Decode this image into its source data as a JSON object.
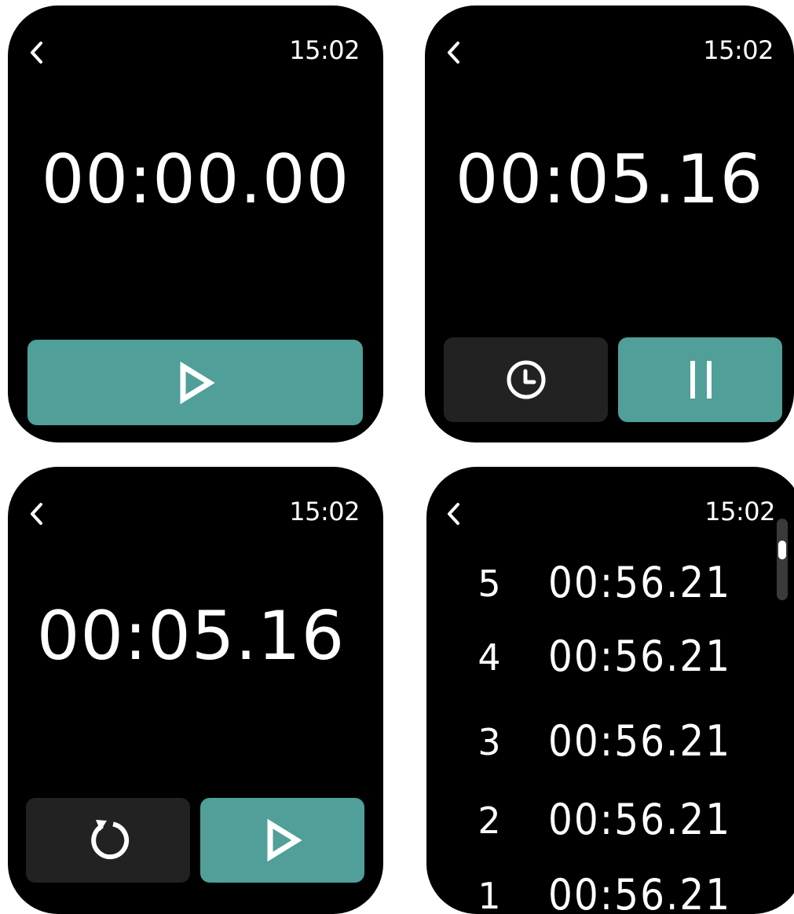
{
  "status_time": "15:02",
  "screens": {
    "initial": {
      "timer": "00:00.00"
    },
    "running": {
      "timer": "00:05.16"
    },
    "paused": {
      "timer": "00:05.16"
    },
    "laps": {
      "items": [
        {
          "number": "5",
          "time": "00:56.21"
        },
        {
          "number": "4",
          "time": "00:56.21"
        },
        {
          "number": "3",
          "time": "00:56.21"
        },
        {
          "number": "2",
          "time": "00:56.21"
        },
        {
          "number": "1",
          "time": "00:56.21"
        }
      ]
    }
  },
  "colors": {
    "accent": "#509f99",
    "secondary_button": "#222222",
    "background": "#000000",
    "text": "#ffffff"
  },
  "icons": {
    "back": "chevron-left-icon",
    "start": "play-icon",
    "pause": "pause-icon",
    "lap": "lap-clock-icon",
    "reset": "reset-icon"
  }
}
